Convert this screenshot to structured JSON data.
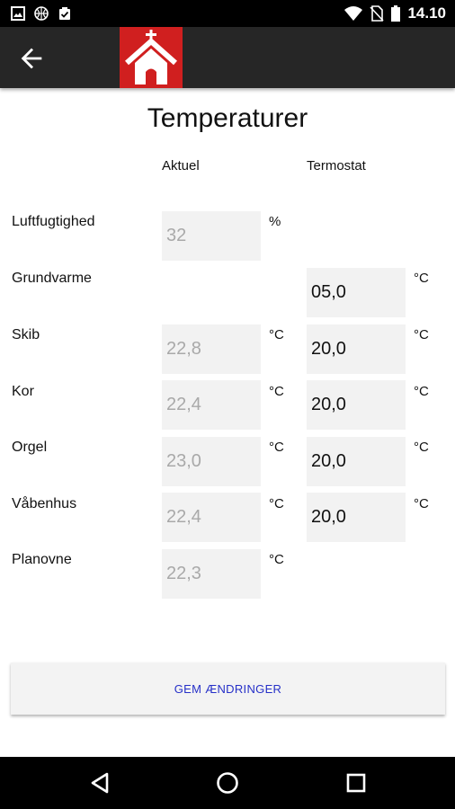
{
  "status_bar": {
    "time": "14.10"
  },
  "title": "Temperaturer",
  "columns": {
    "actual": "Aktuel",
    "thermostat": "Termostat"
  },
  "rows": [
    {
      "label": "Luftfugtighed",
      "actual": "32",
      "actual_unit": "%",
      "thermostat": null,
      "thermostat_unit": null
    },
    {
      "label": "Grundvarme",
      "actual": null,
      "actual_unit": null,
      "thermostat": "05,0",
      "thermostat_unit": "°C"
    },
    {
      "label": "Skib",
      "actual": "22,8",
      "actual_unit": "°C",
      "thermostat": "20,0",
      "thermostat_unit": "°C"
    },
    {
      "label": "Kor",
      "actual": "22,4",
      "actual_unit": "°C",
      "thermostat": "20,0",
      "thermostat_unit": "°C"
    },
    {
      "label": "Orgel",
      "actual": "23,0",
      "actual_unit": "°C",
      "thermostat": "20,0",
      "thermostat_unit": "°C"
    },
    {
      "label": "Våbenhus",
      "actual": "22,4",
      "actual_unit": "°C",
      "thermostat": "20,0",
      "thermostat_unit": "°C"
    },
    {
      "label": "Planovne",
      "actual": "22,3",
      "actual_unit": "°C",
      "thermostat": null,
      "thermostat_unit": null
    }
  ],
  "save_button": {
    "label": "GEM ÆNDRINGER"
  },
  "colors": {
    "logo_red": "#d01f1f",
    "appbar": "#262626",
    "button_text": "#2630c8"
  },
  "icons": {
    "status_left": [
      "image-icon",
      "basketball-icon",
      "clipboard-check-icon"
    ],
    "status_right": [
      "wifi-icon",
      "no-sim-icon",
      "battery-icon"
    ],
    "appbar": [
      "back-arrow-icon",
      "church-logo-icon"
    ],
    "navbar": [
      "back-triangle-icon",
      "home-circle-icon",
      "recents-square-icon"
    ]
  }
}
